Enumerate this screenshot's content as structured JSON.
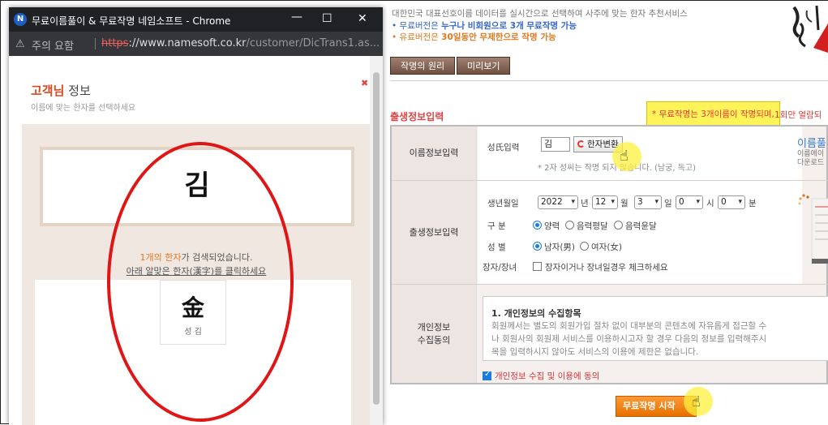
{
  "main": {
    "intro_line1": "대한민국 대표선호이름 데이터를 실시간으로 선택하여 사주에 맞는 한자 추천서비스",
    "intro_line2_prefix": "• 무료버전은 ",
    "intro_line2_bold": "누구나 비회원으로 3개 무료작명 가능",
    "intro_line3_prefix": "• 유료버전은 ",
    "intro_line3_bold": "30일동안 무제한으로 작명 가능",
    "tab_principle": "작명의 원리",
    "tab_preview": "미리보기",
    "section_title": "출생정보입력",
    "notice": "* 무료작명는 3개이름이 작명되며,",
    "notice_rest": "1회만 열람되",
    "name_row": {
      "label": "이름정보입력",
      "surname_label": "성氏입력",
      "surname_value": "김",
      "convert_button": "한자변환",
      "hint": "* 2자 성씨는 작명 되지 않습니다. (남궁, 독고)"
    },
    "birth_row": {
      "label": "출생정보입력",
      "date_label": "생년월일",
      "year": "2022",
      "year_unit": "년",
      "month": "12",
      "month_unit": "월",
      "day": "3",
      "day_unit": "일",
      "hour": "0",
      "hour_unit": "시",
      "minute": "0",
      "minute_unit": "분",
      "calendar_label": "구 분",
      "calendar_options": [
        "양력",
        "음력평달",
        "음력윤달"
      ],
      "gender_label": "성 별",
      "gender_options": [
        "남자(男)",
        "여자(女)"
      ],
      "eldest_label": "장자/장녀",
      "eldest_option": "장자이거나 장녀일경우 체크하세요"
    },
    "privacy_row": {
      "label_line1": "개인정보",
      "label_line2": "수집동의",
      "title": "1. 개인정보의 수집항목",
      "body1": "회원께서는 별도의 회원가입 절차 없이 대부분의 콘텐츠에 자유롭게 접근할 수",
      "body2": "나 회원사의 회원제 서비스를 이용하시고자 할 경우 다음의 정보를 입력해주시",
      "body3": "목을 입력하시지 않아도 서비스의 이용에 제한은 없습니다.",
      "agree": "개인정보 수집 및 이용에 동의"
    },
    "side_title": "이름풀",
    "side_text1": "이름에이",
    "side_text2": "다운로드",
    "submit_button": "무료작명 시작"
  },
  "popup": {
    "window_title": "무료이름풀이 & 무료작명 네임소프트 - Chrome",
    "security_warning": "주의 요함",
    "url_scheme": "https",
    "url_rest": "://www.namesoft.co.kr",
    "url_path": "/customer/DicTrans1.as...",
    "heading_highlight": "고객님",
    "heading_rest": " 정보",
    "subheading": "이름에 맞는 한자를 선택하세요",
    "surname_display": "김",
    "result_count": "1개의 한자",
    "result_text": "가 검색되었습니다.",
    "guide_text": "아래 알맞은 한자(漢字)를 클릭하세요",
    "hanja_results": [
      {
        "hanja": "金",
        "reading": "성 김"
      }
    ]
  },
  "colors": {
    "accent_red": "#e01515",
    "submit_orange": "#ff8a1a",
    "link_blue": "#3366cc",
    "notice_yellow": "#fff35a"
  }
}
